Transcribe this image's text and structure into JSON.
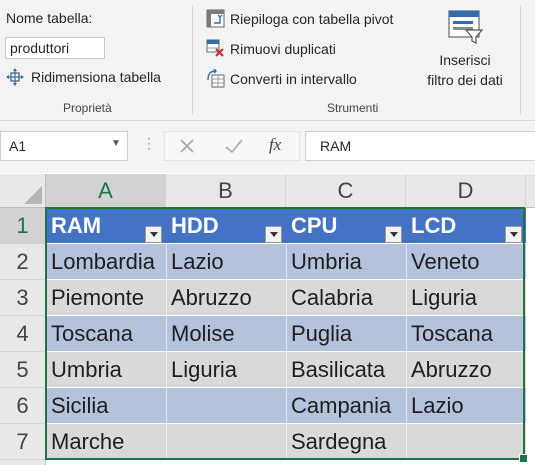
{
  "ribbon": {
    "table_name_label": "Nome tabella:",
    "table_name_value": "produttori",
    "resize_table": "Ridimensiona tabella",
    "group_properties": "Proprietà",
    "summarize_pivot": "Riepiloga con tabella pivot",
    "remove_duplicates": "Rimuovi duplicati",
    "convert_range": "Converti in intervallo",
    "group_tools": "Strumenti",
    "insert_slicer_line1": "Inserisci",
    "insert_slicer_line2": "filtro dei dati"
  },
  "formula_bar": {
    "name_box": "A1",
    "fx": "fx",
    "content": "RAM"
  },
  "sheet": {
    "columns": [
      "A",
      "B",
      "C",
      "D"
    ],
    "rows": [
      "1",
      "2",
      "3",
      "4",
      "5",
      "6",
      "7"
    ],
    "cells": [
      [
        "RAM",
        "HDD",
        "CPU",
        "LCD"
      ],
      [
        "Lombardia",
        "Lazio",
        "Umbria",
        "Veneto"
      ],
      [
        "Piemonte",
        "Abruzzo",
        "Calabria",
        "Liguria"
      ],
      [
        "Toscana",
        "Molise",
        "Puglia",
        "Toscana"
      ],
      [
        "Umbria",
        "Liguria",
        "Basilicata",
        "Abruzzo"
      ],
      [
        "Sicilia",
        "",
        "Campania",
        "Lazio"
      ],
      [
        "Marche",
        "",
        "Sardegna",
        ""
      ]
    ]
  },
  "colors": {
    "header_row": "#4472c4",
    "band_dark": "#b4c2dc",
    "band_light": "#d9d9d9",
    "selection": "#217346",
    "header_selected_text": "#217346"
  }
}
